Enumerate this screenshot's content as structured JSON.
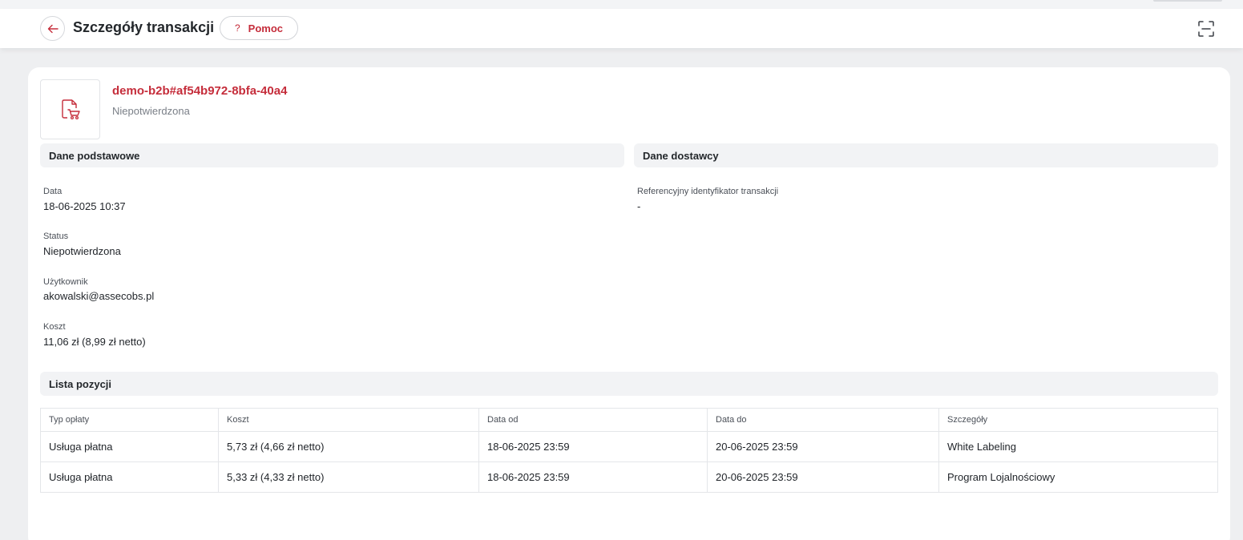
{
  "header": {
    "title": "Szczegóły transakcji",
    "help_label": "Pomoc",
    "help_mark": "?"
  },
  "icons": {
    "back": "arrow-left-icon",
    "help": "question-mark-icon",
    "fullscreen": "fullscreen-icon",
    "transaction": "document-cart-icon"
  },
  "colors": {
    "accent": "#c52d3b",
    "section_bg": "#f2f3f5",
    "page_bg": "#eeeff1"
  },
  "transaction": {
    "id": "demo-b2b#af54b972-8bfa-40a4",
    "status": "Niepotwierdzona"
  },
  "basic": {
    "title": "Dane podstawowe",
    "fields": [
      {
        "label": "Data",
        "value": "18-06-2025 10:37"
      },
      {
        "label": "Status",
        "value": "Niepotwierdzona"
      },
      {
        "label": "Użytkownik",
        "value": "akowalski@assecobs.pl"
      },
      {
        "label": "Koszt",
        "value": "11,06 zł (8,99 zł netto)"
      }
    ]
  },
  "supplier": {
    "title": "Dane dostawcy",
    "fields": [
      {
        "label": "Referencyjny identyfikator transakcji",
        "value": "-"
      }
    ]
  },
  "items": {
    "title": "Lista pozycji",
    "columns": [
      "Typ opłaty",
      "Koszt",
      "Data od",
      "Data do",
      "Szczegóły"
    ],
    "rows": [
      [
        "Usługa płatna",
        "5,73 zł (4,66 zł netto)",
        "18-06-2025 23:59",
        "20-06-2025 23:59",
        "White Labeling"
      ],
      [
        "Usługa płatna",
        "5,33 zł (4,33 zł netto)",
        "18-06-2025 23:59",
        "20-06-2025 23:59",
        "Program Lojalnościowy"
      ]
    ]
  }
}
